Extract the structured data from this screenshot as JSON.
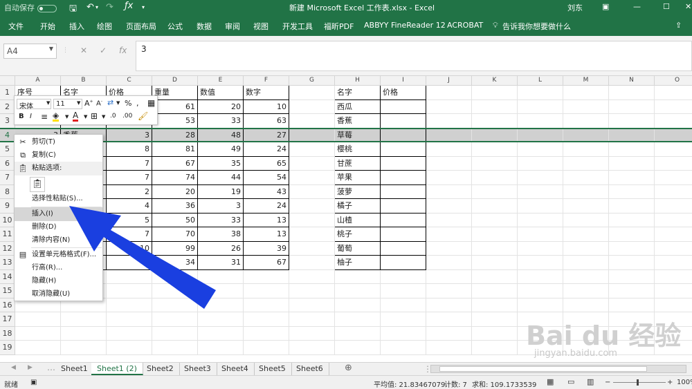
{
  "title": {
    "autosave": "自动保存",
    "doc_title": "新建 Microsoft Excel 工作表.xlsx  -  Excel",
    "user": "刘东"
  },
  "ribbon": {
    "tabs": [
      "文件",
      "开始",
      "插入",
      "绘图",
      "页面布局",
      "公式",
      "数据",
      "审阅",
      "视图",
      "开发工具",
      "福昕PDF",
      "ABBYY FineReader 12",
      "ACROBAT"
    ],
    "tell_me": "告诉我你想要做什么"
  },
  "formula": {
    "name_box": "A4",
    "value": "3"
  },
  "columns": [
    "A",
    "B",
    "C",
    "D",
    "E",
    "F",
    "G",
    "H",
    "I",
    "J",
    "K",
    "L",
    "M",
    "N",
    "O"
  ],
  "rows": [
    "1",
    "2",
    "3",
    "4",
    "5",
    "6",
    "7",
    "8",
    "9",
    "10",
    "11",
    "12",
    "13",
    "14",
    "15",
    "16",
    "17",
    "18",
    "19"
  ],
  "table": {
    "headers": [
      "序号",
      "名字",
      "价格",
      "重量",
      "数值",
      "数字"
    ],
    "rows": [
      [
        "",
        "",
        "",
        "61",
        "20",
        "10"
      ],
      [
        "",
        "",
        "",
        "53",
        "33",
        "63"
      ],
      [
        "3",
        "香蕉",
        "3",
        "28",
        "48",
        "27"
      ],
      [
        "",
        "",
        "8",
        "81",
        "49",
        "24"
      ],
      [
        "",
        "",
        "7",
        "67",
        "35",
        "65"
      ],
      [
        "",
        "",
        "7",
        "74",
        "44",
        "54"
      ],
      [
        "",
        "",
        "2",
        "20",
        "19",
        "43"
      ],
      [
        "",
        "",
        "4",
        "36",
        "3",
        "24"
      ],
      [
        "",
        "",
        "5",
        "50",
        "33",
        "13"
      ],
      [
        "",
        "",
        "7",
        "70",
        "38",
        "13"
      ],
      [
        "",
        "",
        "10",
        "99",
        "26",
        "39"
      ],
      [
        "",
        "",
        "",
        "34",
        "31",
        "67"
      ]
    ]
  },
  "table2": {
    "headers": [
      "名字",
      "价格"
    ],
    "names": [
      "西瓜",
      "香蕉",
      "草莓",
      "樱桃",
      "甘蔗",
      "苹果",
      "菠萝",
      "橘子",
      "山楂",
      "桃子",
      "葡萄",
      "柚子"
    ]
  },
  "mini_toolbar": {
    "font": "宋体",
    "size": "11",
    "percent": "%"
  },
  "context_menu": {
    "items": [
      "剪切(T)",
      "复制(C)",
      "粘贴选项:",
      "选择性粘贴(S)...",
      "插入(I)",
      "删除(D)",
      "清除内容(N)",
      "设置单元格格式(F)...",
      "行高(R)...",
      "隐藏(H)",
      "取消隐藏(U)"
    ]
  },
  "sheets": [
    "Sheet1",
    "Sheet1 (2)",
    "Sheet2",
    "Sheet3",
    "Sheet4",
    "Sheet5",
    "Sheet6"
  ],
  "status": {
    "mode": "就绪",
    "average": "平均值: 21.83467079",
    "count": "计数: 7",
    "sum": "求和: 109.1733539",
    "zoom": "100%"
  },
  "watermark": {
    "logo": "Bai du 经验",
    "url": "jingyan.baidu.com"
  },
  "colors": {
    "accent": "#217346",
    "arrow": "#1a3fe0"
  }
}
